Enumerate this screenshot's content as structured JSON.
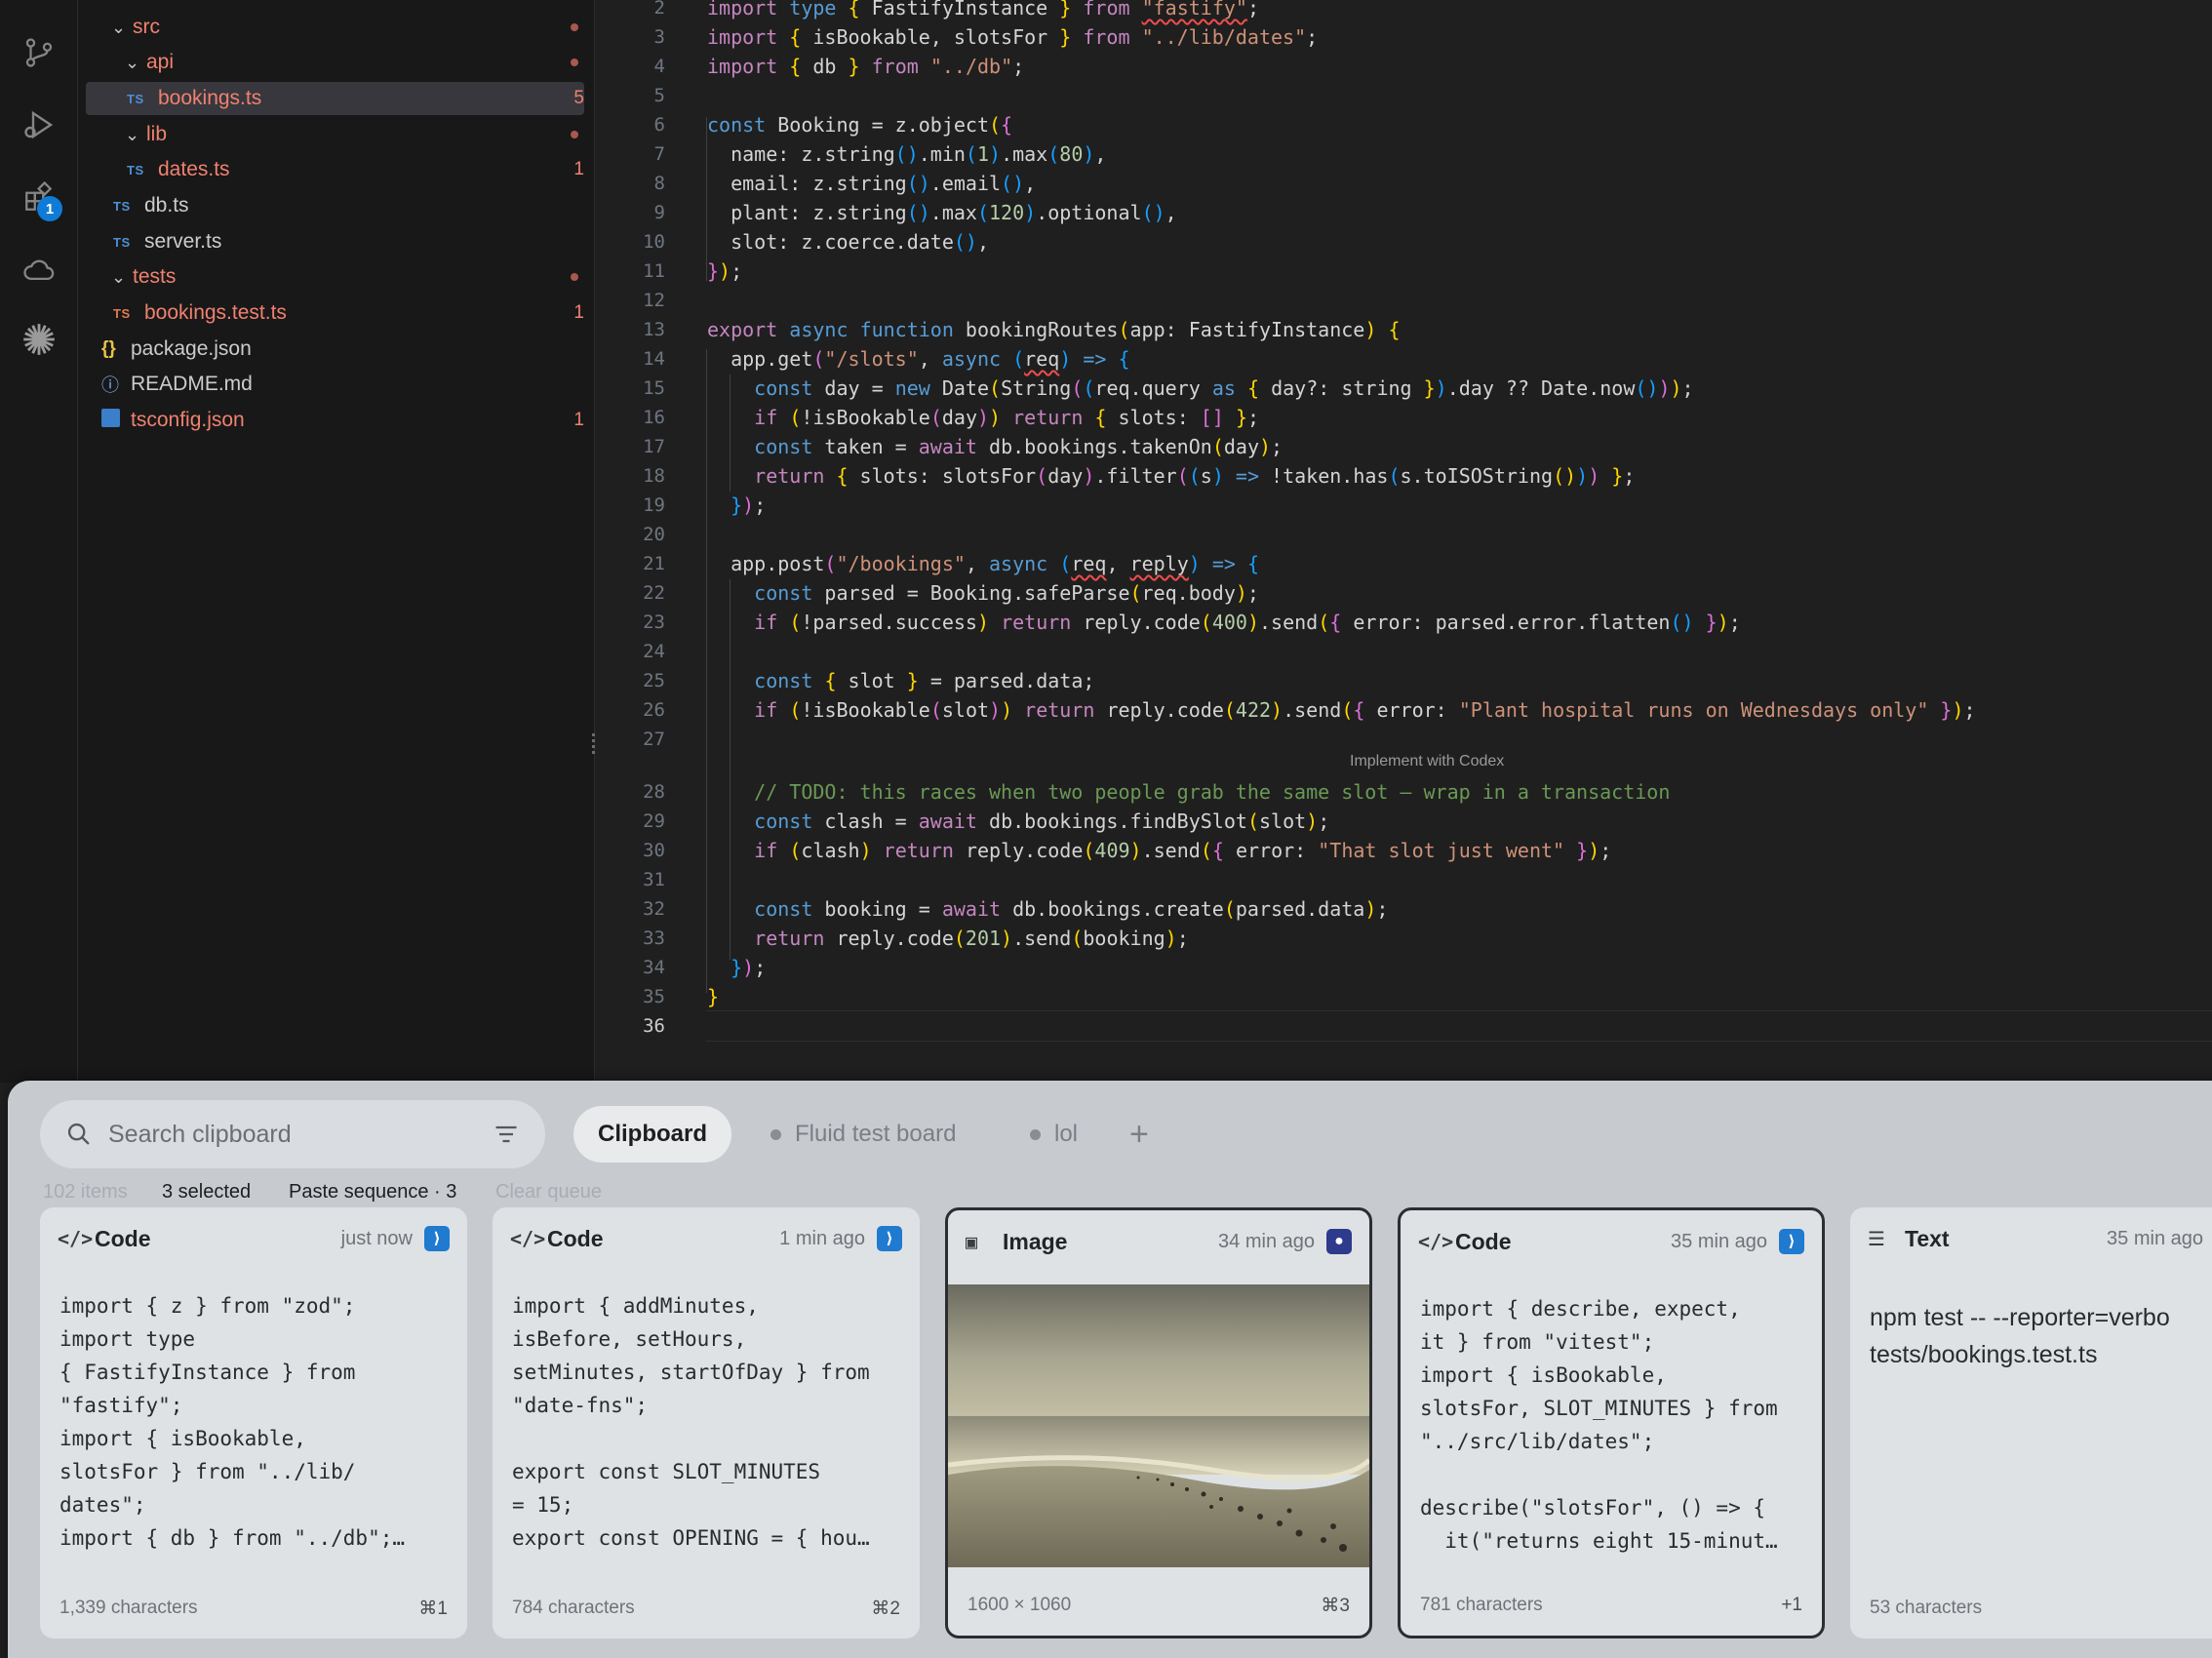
{
  "explorer": {
    "items": [
      {
        "label": "src",
        "kind": "folder",
        "open": true,
        "error": true,
        "count": ""
      },
      {
        "label": "api",
        "kind": "folder",
        "open": true,
        "error": true,
        "count": ""
      },
      {
        "label": "bookings.ts",
        "kind": "ts",
        "error": true,
        "count": "5",
        "selected": true
      },
      {
        "label": "lib",
        "kind": "folder",
        "open": true,
        "error": true,
        "count": ""
      },
      {
        "label": "dates.ts",
        "kind": "ts",
        "error": true,
        "count": "1"
      },
      {
        "label": "db.ts",
        "kind": "ts",
        "error": false,
        "count": ""
      },
      {
        "label": "server.ts",
        "kind": "ts",
        "error": false,
        "count": ""
      },
      {
        "label": "tests",
        "kind": "folder",
        "open": true,
        "error": true,
        "count": ""
      },
      {
        "label": "bookings.test.ts",
        "kind": "ts",
        "error": true,
        "count": "1"
      },
      {
        "label": "package.json",
        "kind": "json",
        "error": false,
        "count": ""
      },
      {
        "label": "README.md",
        "kind": "info",
        "error": false,
        "count": ""
      },
      {
        "label": "tsconfig.json",
        "kind": "tsconfig",
        "error": true,
        "count": "1"
      }
    ],
    "badge": "1"
  },
  "editor": {
    "codelens": "Implement with Codex",
    "active_line": "36",
    "line_numbers": [
      "2",
      "3",
      "4",
      "5",
      "6",
      "7",
      "8",
      "9",
      "10",
      "11",
      "12",
      "13",
      "14",
      "15",
      "16",
      "17",
      "18",
      "19",
      "20",
      "21",
      "22",
      "23",
      "24",
      "25",
      "26",
      "27",
      "28",
      "29",
      "30",
      "31",
      "32",
      "33",
      "34",
      "35",
      "36"
    ]
  },
  "clipboard": {
    "search_placeholder": "Search clipboard",
    "tabs": [
      "Clipboard",
      "Fluid test board",
      "lol"
    ],
    "item_count": "102 items",
    "selected": "3 selected",
    "paste_sequence": "Paste sequence · 3",
    "clear_queue": "Clear queue",
    "cards": [
      {
        "kind": "Code",
        "time": "just now",
        "app": "vscode",
        "body": "import { z } from \"zod\";\nimport type\n{ FastifyInstance } from\n\"fastify\";\nimport { isBookable,\nslotsFor } from \"../lib/\ndates\";\nimport { db } from \"../db\";…",
        "footer": "1,339 characters",
        "shortcut": "⌘1"
      },
      {
        "kind": "Code",
        "time": "1 min ago",
        "app": "vscode",
        "body": "import { addMinutes,\nisBefore, setHours,\nsetMinutes, startOfDay } from\n\"date-fns\";\n\nexport const SLOT_MINUTES\n= 15;\nexport const OPENING = { hou…",
        "footer": "784 characters",
        "shortcut": "⌘2"
      },
      {
        "kind": "Image",
        "time": "34 min ago",
        "app": "other",
        "body": "",
        "footer": "1600 × 1060",
        "shortcut": "⌘3"
      },
      {
        "kind": "Code",
        "time": "35 min ago",
        "app": "vscode",
        "body": "import { describe, expect,\nit } from \"vitest\";\nimport { isBookable,\nslotsFor, SLOT_MINUTES } from\n\"../src/lib/dates\";\n\ndescribe(\"slotsFor\", () => {\n  it(\"returns eight 15-minut…",
        "footer": "781 characters",
        "shortcut": "+1"
      },
      {
        "kind": "Text",
        "time": "35 min ago",
        "app": "",
        "body": "npm test -- --reporter=verbo\ntests/bookings.test.ts",
        "footer": "53 characters",
        "shortcut": ""
      }
    ]
  },
  "colors": {
    "accent": "#1f7ad0",
    "error": "#f0816f",
    "panel": "#c7cbd0"
  }
}
